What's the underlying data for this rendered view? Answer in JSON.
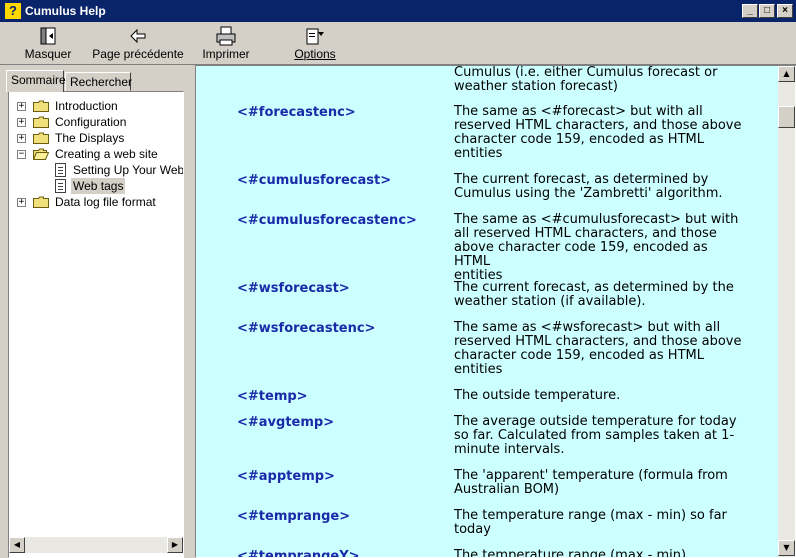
{
  "window": {
    "title": "Cumulus Help",
    "icon": "?",
    "controls": {
      "minimize": "_",
      "maximize": "□",
      "close": "×"
    }
  },
  "toolbar": {
    "hide_label": "Masquer",
    "back_label": "Page précédente",
    "print_label": "Imprimer",
    "options_label": "Options"
  },
  "tabs": {
    "contents": "Sommaire",
    "search": "Rechercher"
  },
  "tree": {
    "items": [
      {
        "label": "Introduction",
        "expander": "+",
        "icon": "folder-icon"
      },
      {
        "label": "Configuration",
        "expander": "+",
        "icon": "folder-icon"
      },
      {
        "label": "The Displays",
        "expander": "+",
        "icon": "folder-icon"
      },
      {
        "label": "Creating a web site",
        "expander": "−",
        "icon": "open-folder-icon"
      },
      {
        "label": "Setting Up Your Web",
        "icon": "page-icon"
      },
      {
        "label": "Web tags",
        "icon": "page-icon",
        "selected": true
      },
      {
        "label": "Data log file format",
        "expander": "+",
        "icon": "folder-icon"
      }
    ]
  },
  "content": {
    "background": "#ccffff",
    "tag_color": "#1a2aa8",
    "top_fragment": [
      "Cumulus (i.e. either Cumulus forecast or",
      "weather station forecast)"
    ],
    "entries": [
      {
        "tag": "<#forecastenc>",
        "lines": [
          "The same as <#forecast> but with all",
          "reserved HTML characters, and those above",
          "character code 159, encoded as HTML",
          "entities"
        ]
      },
      {
        "tag": "<#cumulusforecast>",
        "lines": [
          "The current forecast, as determined by",
          "Cumulus using the 'Zambretti' algorithm."
        ]
      },
      {
        "tag": "<#cumulusforecastenc>",
        "lines": [
          "The same as <#cumulusforecast> but with",
          "all reserved HTML characters, and those",
          "above character code 159, encoded as HTML",
          "entities"
        ]
      },
      {
        "tag": "<#wsforecast>",
        "lines": [
          "The current forecast, as determined by the",
          "weather station (if available)."
        ]
      },
      {
        "tag": "<#wsforecastenc>",
        "lines": [
          "The same as <#wsforecast> but with all",
          "reserved HTML characters, and those above",
          "character code 159, encoded as HTML",
          "entities"
        ]
      },
      {
        "tag": "<#temp>",
        "lines": [
          "The outside temperature."
        ]
      },
      {
        "tag": "<#avgtemp>",
        "lines": [
          "The average outside temperature for today",
          "so far. Calculated from samples taken at 1-",
          "minute intervals."
        ]
      },
      {
        "tag": "<#apptemp>",
        "lines": [
          "The 'apparent' temperature (formula from",
          "Australian BOM)"
        ]
      },
      {
        "tag": "<#temprange>",
        "lines": [
          "The temperature range (max - min) so far",
          "today"
        ]
      },
      {
        "tag": "<#temprangeY>",
        "lines": [
          "The temperature range (max - min)"
        ]
      }
    ]
  },
  "scrollbar": {
    "up": "▲",
    "down": "▼",
    "left": "◀",
    "right": "▶"
  }
}
